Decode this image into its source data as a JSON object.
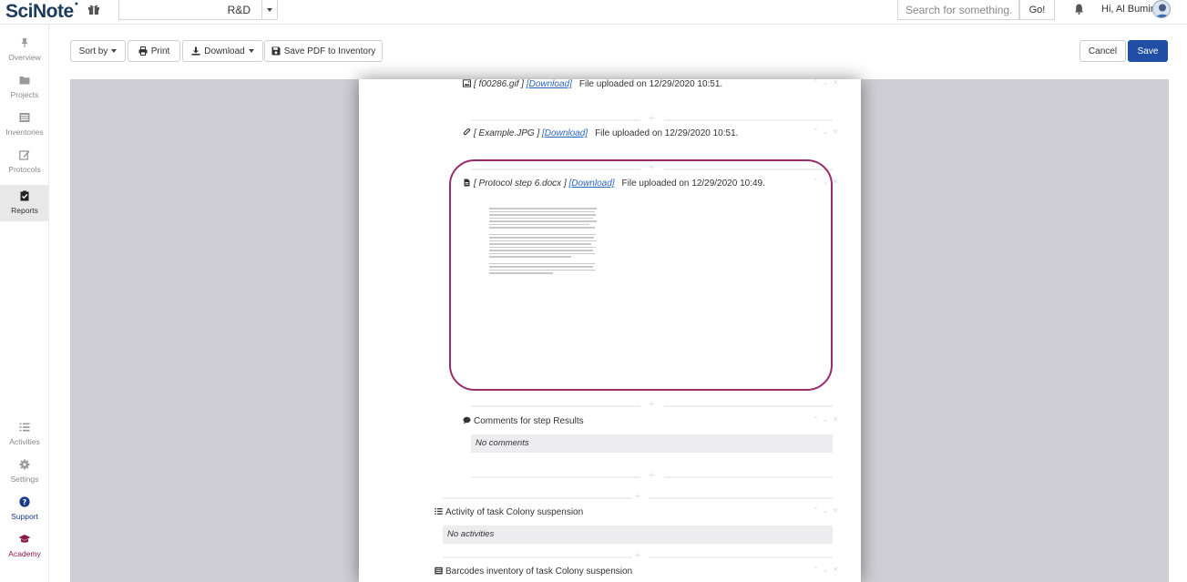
{
  "header": {
    "logo_text": "SciNote",
    "team_name": "R&D",
    "search_placeholder": "Search for something...",
    "go_label": "Go!",
    "greeting": "Hi, Al Bumin"
  },
  "sidebar": {
    "items": [
      {
        "label": "Overview",
        "icon": "pin-icon"
      },
      {
        "label": "Projects",
        "icon": "folder-icon"
      },
      {
        "label": "Inventories",
        "icon": "list-box-icon"
      },
      {
        "label": "Protocols",
        "icon": "edit-icon"
      },
      {
        "label": "Reports",
        "icon": "clipboard-check-icon",
        "active": true
      },
      {
        "label": "Activities",
        "icon": "list-icon"
      },
      {
        "label": "Settings",
        "icon": "gear-icon"
      },
      {
        "label": "Support",
        "icon": "question-circle-icon"
      },
      {
        "label": "Academy",
        "icon": "graduation-cap-icon"
      }
    ]
  },
  "toolbar": {
    "sort_label": "Sort by",
    "print_label": "Print",
    "download_label": "Download",
    "save_pdf_label": "Save PDF to Inventory",
    "cancel_label": "Cancel",
    "save_label": "Save"
  },
  "report": {
    "file1": {
      "name": "[ f00286.gif ]",
      "link": "[Download]",
      "meta": "File uploaded on 12/29/2020 10:51."
    },
    "file2": {
      "name": "[ Example.JPG ]",
      "link": "[Download]",
      "meta": "File uploaded on 12/29/2020 10:51."
    },
    "file3": {
      "name": "[ Protocol step 6.docx ]",
      "link": "[Download]",
      "meta": "File uploaded on 12/29/2020 10:49."
    },
    "comments": {
      "title": "Comments for step Results",
      "empty": "No comments"
    },
    "activity": {
      "title": "Activity of task Colony suspension",
      "empty": "No activities"
    },
    "barcodes": {
      "title": "Barcodes inventory of task Colony suspension"
    }
  },
  "colors": {
    "brand": "#1b3a5c",
    "save_button": "#1f4ea4",
    "highlight": "#9a2a6a",
    "link": "#2a65c0"
  }
}
